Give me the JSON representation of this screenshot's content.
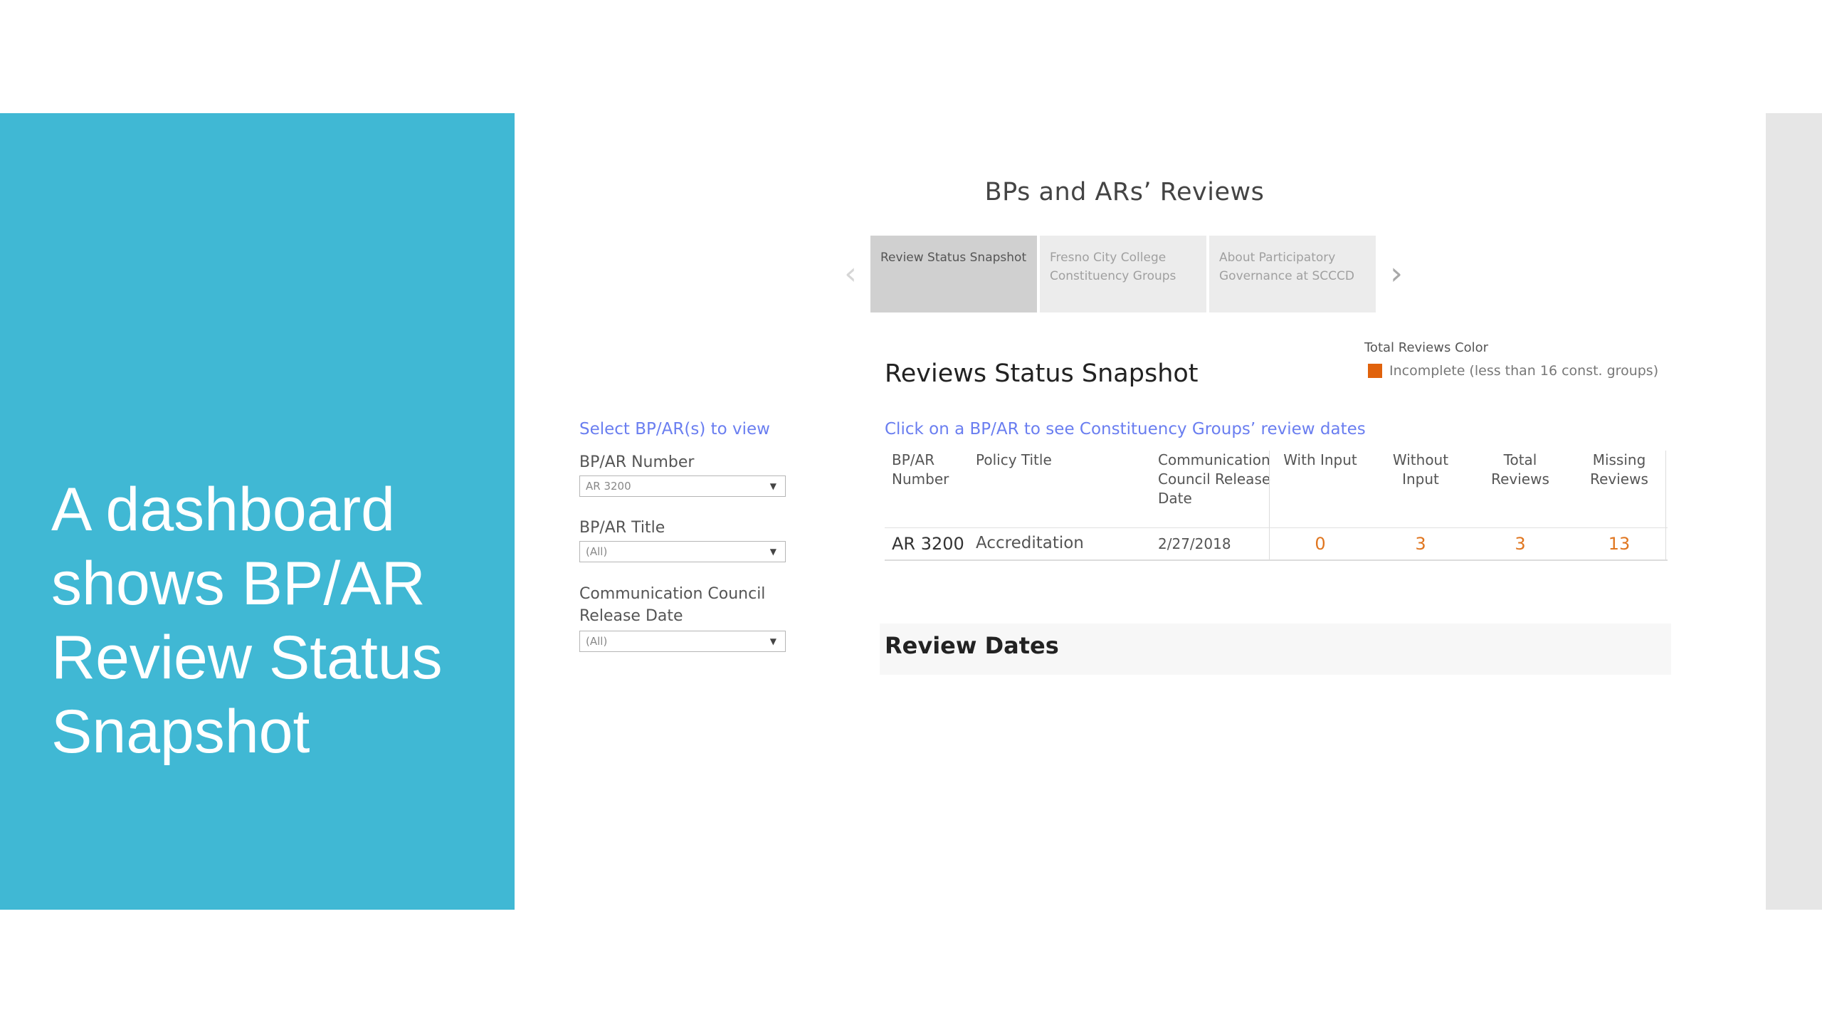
{
  "slide": {
    "title": "A dashboard shows BP/AR Review Status Snapshot"
  },
  "dashboard": {
    "title": "BPs and ARs’ Reviews",
    "tabs": [
      {
        "label": "Review Status Snapshot",
        "active": true
      },
      {
        "label": "Fresno City College Constituency Groups",
        "active": false
      },
      {
        "label": "About Participatory Governance at SCCCD",
        "active": false
      }
    ],
    "prev_icon": "chevron-left-icon",
    "next_icon": "chevron-right-icon"
  },
  "filters": {
    "hint": "Select BP/AR(s) to view",
    "bp_ar_number": {
      "label": "BP/AR Number",
      "value": "AR 3200"
    },
    "bp_ar_title": {
      "label": "BP/AR Title",
      "value": "(All)"
    },
    "release_date": {
      "label": "Communication Council Release Date",
      "value": "(All)"
    }
  },
  "snapshot": {
    "title": "Reviews Status Snapshot",
    "legend_title": "Total Reviews Color",
    "legend_item": "Incomplete (less than 16 const. groups)",
    "legend_color": "#e0620c",
    "hint": "Click on a BP/AR to see Constituency Groups’ review dates",
    "columns": {
      "number": "BP/AR Number",
      "policy_title": "Policy Title",
      "release_date": "Communication Council Release Date",
      "with_input": "With Input",
      "without_input": "Without Input",
      "total_reviews": "Total Reviews",
      "missing_reviews": "Missing Reviews"
    },
    "rows": [
      {
        "number": "AR 3200",
        "policy_title": "Accreditation",
        "release_date": "2/27/2018",
        "with_input": "0",
        "without_input": "3",
        "total_reviews": "3",
        "missing_reviews": "13"
      }
    ]
  },
  "review_dates": {
    "title": "Review Dates"
  }
}
